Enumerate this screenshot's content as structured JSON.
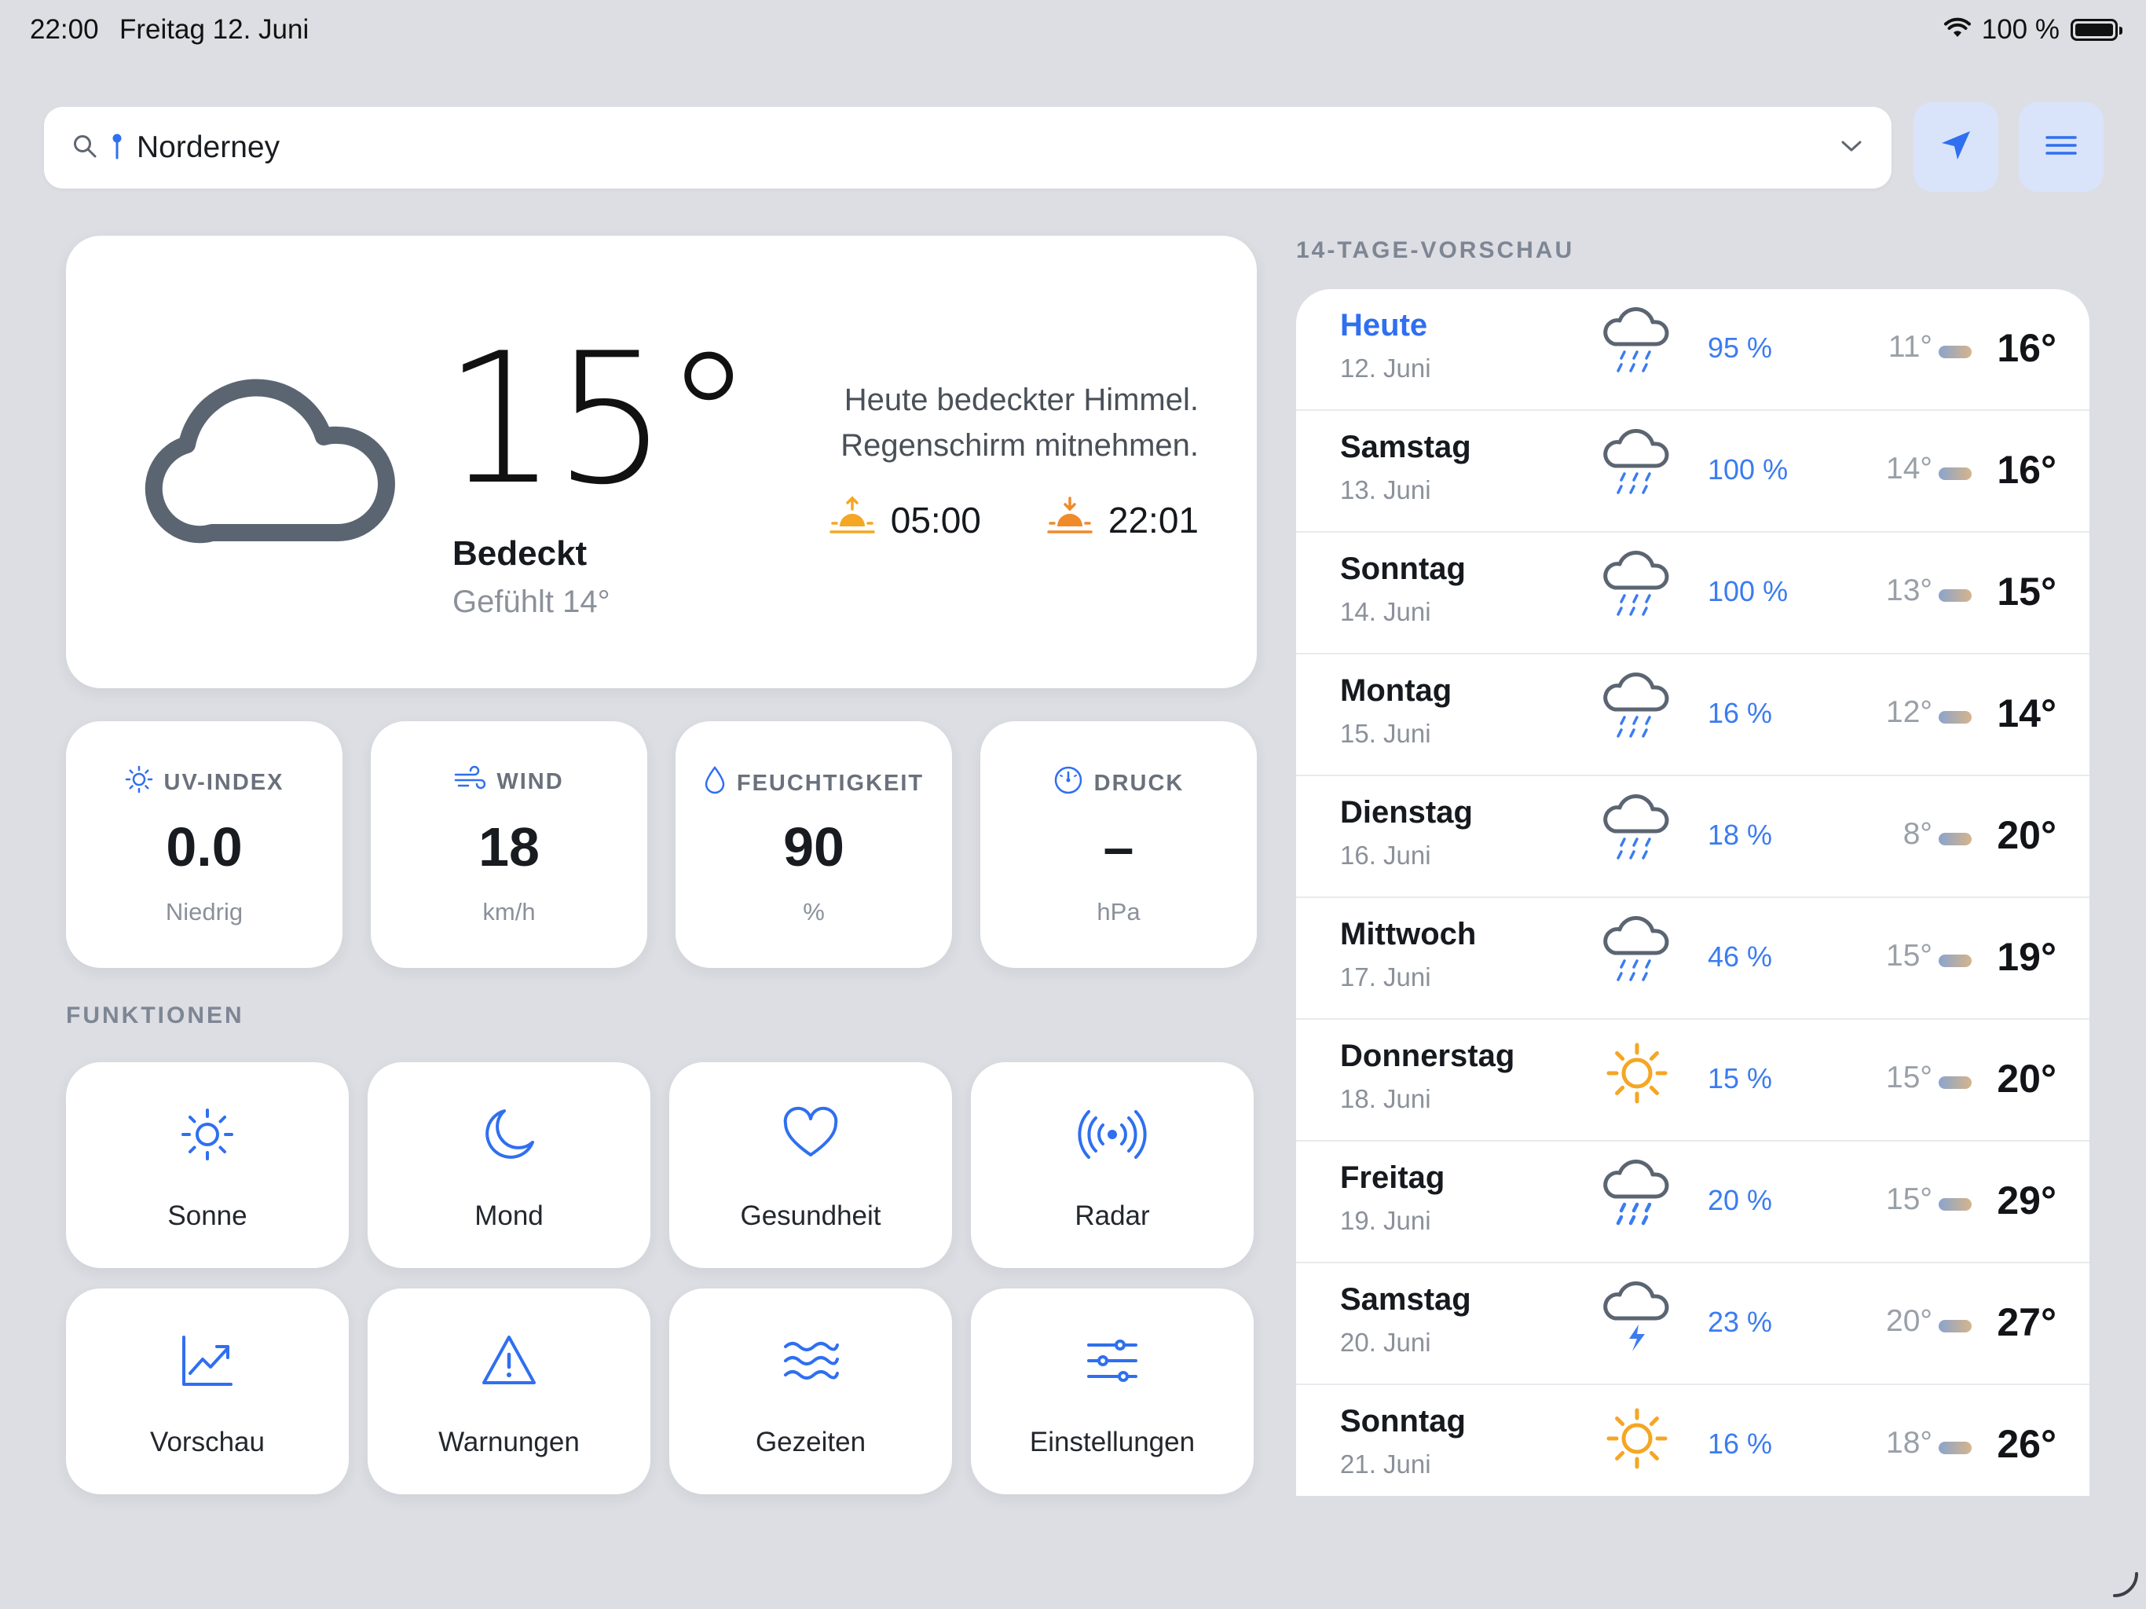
{
  "status_bar": {
    "time": "22:00",
    "date": "Freitag 12. Juni",
    "battery": "100 %"
  },
  "search": {
    "location": "Norderney"
  },
  "current": {
    "temp": "15°",
    "condition": "Bedeckt",
    "feels_like": "Gefühlt 14°",
    "description_line1": "Heute bedeckter Himmel.",
    "description_line2": "Regenschirm mitnehmen.",
    "sunrise": "05:00",
    "sunset": "22:01"
  },
  "stats": [
    {
      "label": "UV-INDEX",
      "value": "0.0",
      "unit": "Niedrig",
      "icon": "sun-icon"
    },
    {
      "label": "WIND",
      "value": "18",
      "unit": "km/h",
      "icon": "wind-icon"
    },
    {
      "label": "FEUCHTIGKEIT",
      "value": "90",
      "unit": "%",
      "icon": "drop-icon"
    },
    {
      "label": "DRUCK",
      "value": "–",
      "unit": "hPa",
      "icon": "gauge-icon"
    }
  ],
  "functions_label": "FUNKTIONEN",
  "functions": [
    {
      "label": "Sonne",
      "icon": "sun-icon"
    },
    {
      "label": "Mond",
      "icon": "moon-icon"
    },
    {
      "label": "Gesundheit",
      "icon": "heart-icon"
    },
    {
      "label": "Radar",
      "icon": "radar-icon"
    },
    {
      "label": "Vorschau",
      "icon": "chart-icon"
    },
    {
      "label": "Warnungen",
      "icon": "warning-icon"
    },
    {
      "label": "Gezeiten",
      "icon": "waves-icon"
    },
    {
      "label": "Einstellungen",
      "icon": "sliders-icon"
    }
  ],
  "forecast_label": "14-TAGE-VORSCHAU",
  "forecast": [
    {
      "day": "Heute",
      "date": "12. Juni",
      "icon": "rain",
      "precip": "95 %",
      "low": "11°",
      "high": "16°"
    },
    {
      "day": "Samstag",
      "date": "13. Juni",
      "icon": "rain",
      "precip": "100 %",
      "low": "14°",
      "high": "16°"
    },
    {
      "day": "Sonntag",
      "date": "14. Juni",
      "icon": "rain",
      "precip": "100 %",
      "low": "13°",
      "high": "15°"
    },
    {
      "day": "Montag",
      "date": "15. Juni",
      "icon": "rain",
      "precip": "16 %",
      "low": "12°",
      "high": "14°"
    },
    {
      "day": "Dienstag",
      "date": "16. Juni",
      "icon": "rain",
      "precip": "18 %",
      "low": "8°",
      "high": "20°"
    },
    {
      "day": "Mittwoch",
      "date": "17. Juni",
      "icon": "rain",
      "precip": "46 %",
      "low": "15°",
      "high": "19°"
    },
    {
      "day": "Donnerstag",
      "date": "18. Juni",
      "icon": "sun",
      "precip": "15 %",
      "low": "15°",
      "high": "20°"
    },
    {
      "day": "Freitag",
      "date": "19. Juni",
      "icon": "heavy-rain",
      "precip": "20 %",
      "low": "15°",
      "high": "29°"
    },
    {
      "day": "Samstag",
      "date": "20. Juni",
      "icon": "thunder",
      "precip": "23 %",
      "low": "20°",
      "high": "27°"
    },
    {
      "day": "Sonntag",
      "date": "21. Juni",
      "icon": "sun",
      "precip": "16 %",
      "low": "18°",
      "high": "26°"
    }
  ],
  "colors": {
    "accent": "#2f6ff0",
    "sun": "#f5a623",
    "cloud": "#5b6572",
    "background": "#dcdee3"
  }
}
